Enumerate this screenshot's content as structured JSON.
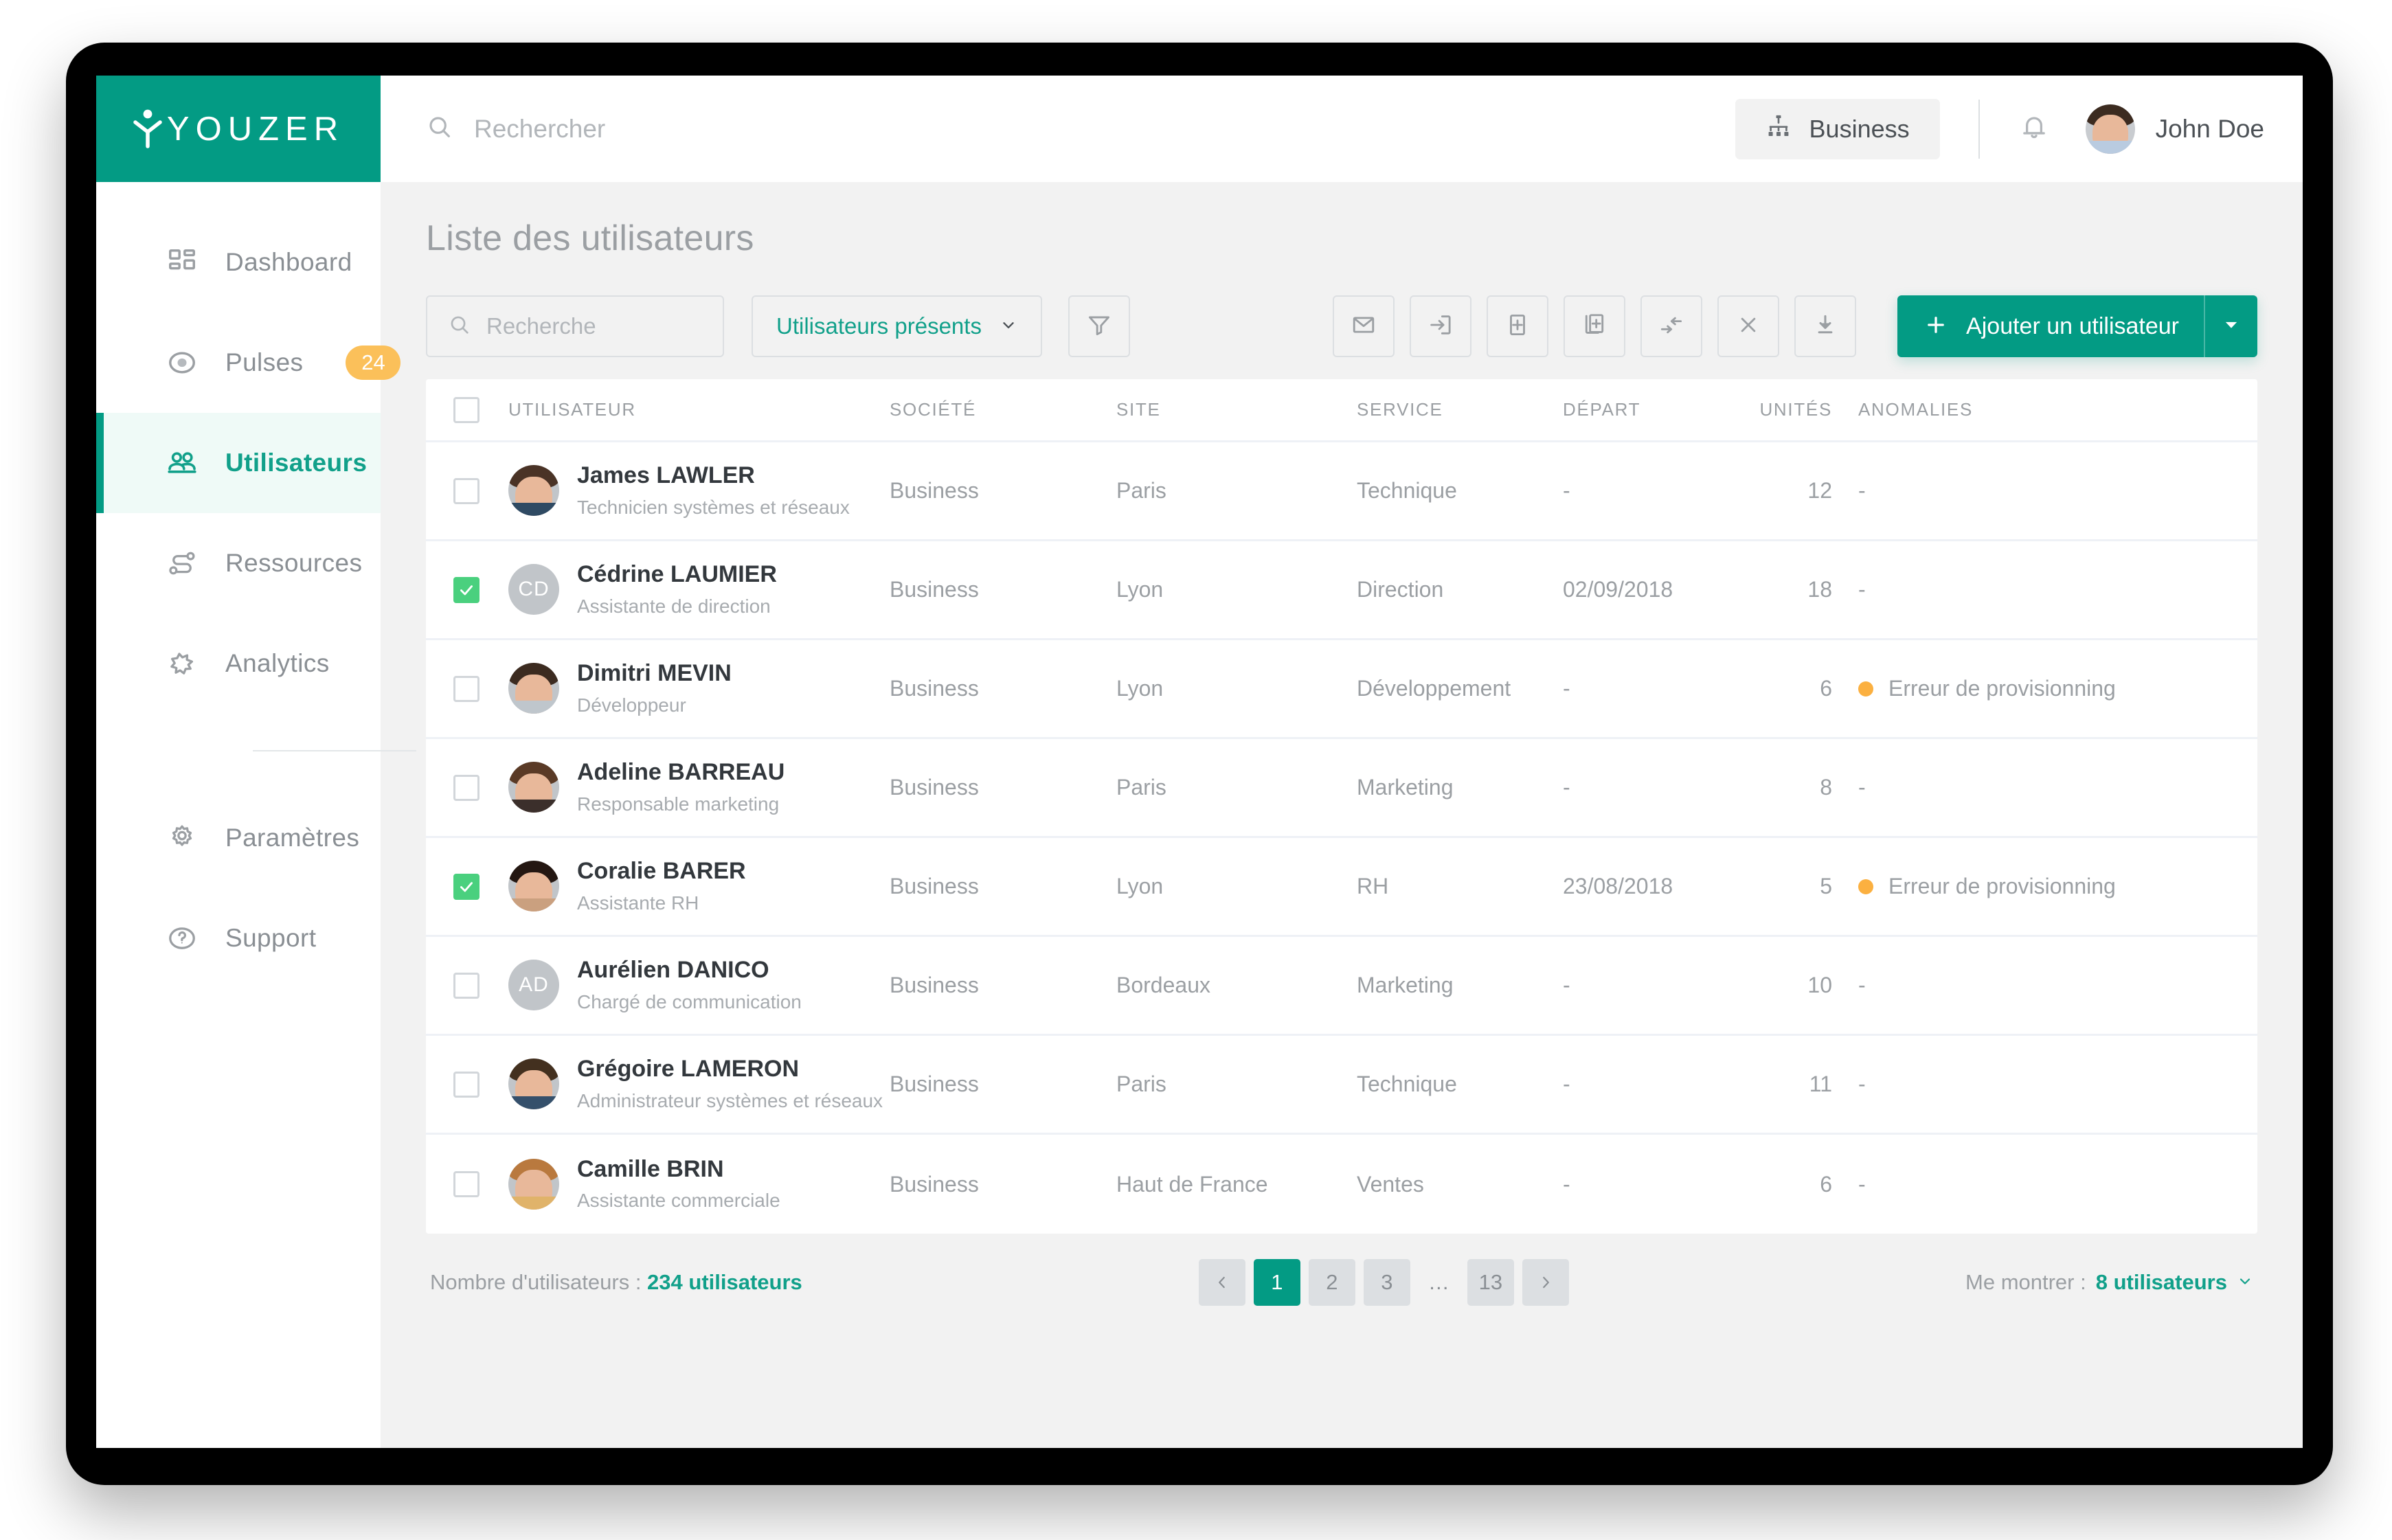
{
  "brand": {
    "name": "YOUZER",
    "color": "#039b84"
  },
  "sidebar": {
    "items": [
      {
        "label": "Dashboard",
        "icon": "dashboard-icon",
        "badge": null,
        "active": false
      },
      {
        "label": "Pulses",
        "icon": "pulse-icon",
        "badge": "24",
        "active": false
      },
      {
        "label": "Utilisateurs",
        "icon": "users-icon",
        "badge": null,
        "active": true
      },
      {
        "label": "Ressources",
        "icon": "resources-icon",
        "badge": null,
        "active": false
      },
      {
        "label": "Analytics",
        "icon": "analytics-icon",
        "badge": null,
        "active": false
      },
      {
        "label": "Paramètres",
        "icon": "gear-icon",
        "badge": null,
        "active": false
      },
      {
        "label": "Support",
        "icon": "help-icon",
        "badge": null,
        "active": false
      }
    ]
  },
  "topbar": {
    "search_placeholder": "Rechercher",
    "search_value": "",
    "search_icon": "search-icon",
    "business_label": "Business",
    "business_icon": "org-chart-icon",
    "bell_icon": "bell-icon",
    "user_name": "John Doe",
    "avatar_icon": "avatar"
  },
  "page": {
    "title": "Liste des utilisateurs"
  },
  "toolbar": {
    "search_placeholder": "Recherche",
    "search_value": "",
    "search_icon": "search-icon",
    "status_filter_label": "Utilisateurs présents",
    "status_filter_caret": "chevron-down-icon",
    "filter_icon": "funnel-icon",
    "actions": [
      {
        "name": "mail-button",
        "icon": "envelope-icon"
      },
      {
        "name": "import-button",
        "icon": "arrow-into-box-icon"
      },
      {
        "name": "add-document-button",
        "icon": "plus-in-box-icon"
      },
      {
        "name": "duplicate-button",
        "icon": "copy-plus-icon"
      },
      {
        "name": "merge-button",
        "icon": "merge-arrows-icon"
      },
      {
        "name": "close-button",
        "icon": "x-icon"
      },
      {
        "name": "download-button",
        "icon": "download-icon"
      }
    ],
    "add_user_label": "Ajouter un utilisateur",
    "add_user_plus_icon": "plus-icon",
    "add_user_caret_icon": "caret-down-icon"
  },
  "table": {
    "columns": [
      "UTILISATEUR",
      "SOCIÉTÉ",
      "SITE",
      "SERVICE",
      "DÉPART",
      "UNITÉS",
      "ANOMALIES"
    ],
    "select_all_checked": false,
    "rows": [
      {
        "checked": false,
        "avatar_type": "photo",
        "avatar_initials": "",
        "name": "James LAWLER",
        "role": "Technicien systèmes et réseaux",
        "societe": "Business",
        "site": "Paris",
        "service": "Technique",
        "depart": "-",
        "unites": "12",
        "anomalie": "-",
        "anomalie_flag": false
      },
      {
        "checked": true,
        "avatar_type": "initials",
        "avatar_initials": "CD",
        "name": "Cédrine LAUMIER",
        "role": "Assistante de direction",
        "societe": "Business",
        "site": "Lyon",
        "service": "Direction",
        "depart": "02/09/2018",
        "unites": "18",
        "anomalie": "-",
        "anomalie_flag": false
      },
      {
        "checked": false,
        "avatar_type": "photo",
        "avatar_initials": "",
        "name": "Dimitri MEVIN",
        "role": "Développeur",
        "societe": "Business",
        "site": "Lyon",
        "service": "Développement",
        "depart": "-",
        "unites": "6",
        "anomalie": "Erreur de provisionning",
        "anomalie_flag": true
      },
      {
        "checked": false,
        "avatar_type": "photo",
        "avatar_initials": "",
        "name": "Adeline BARREAU",
        "role": "Responsable marketing",
        "societe": "Business",
        "site": "Paris",
        "service": "Marketing",
        "depart": "-",
        "unites": "8",
        "anomalie": "-",
        "anomalie_flag": false
      },
      {
        "checked": true,
        "avatar_type": "photo",
        "avatar_initials": "",
        "name": "Coralie BARER",
        "role": "Assistante RH",
        "societe": "Business",
        "site": "Lyon",
        "service": "RH",
        "depart": "23/08/2018",
        "unites": "5",
        "anomalie": "Erreur de provisionning",
        "anomalie_flag": true
      },
      {
        "checked": false,
        "avatar_type": "initials",
        "avatar_initials": "AD",
        "name": "Aurélien DANICO",
        "role": "Chargé de communication",
        "societe": "Business",
        "site": "Bordeaux",
        "service": "Marketing",
        "depart": "-",
        "unites": "10",
        "anomalie": "-",
        "anomalie_flag": false
      },
      {
        "checked": false,
        "avatar_type": "photo",
        "avatar_initials": "",
        "name": "Grégoire LAMERON",
        "role": "Administrateur systèmes et réseaux",
        "societe": "Business",
        "site": "Paris",
        "service": "Technique",
        "depart": "-",
        "unites": "11",
        "anomalie": "-",
        "anomalie_flag": false
      },
      {
        "checked": false,
        "avatar_type": "photo",
        "avatar_initials": "",
        "name": "Camille BRIN",
        "role": "Assistante commerciale",
        "societe": "Business",
        "site": "Haut de France",
        "service": "Ventes",
        "depart": "-",
        "unites": "6",
        "anomalie": "-",
        "anomalie_flag": false
      }
    ]
  },
  "footer": {
    "count_label": "Nombre d'utilisateurs : ",
    "count_value": "234 utilisateurs",
    "pagination": {
      "prev_icon": "chevron-left-icon",
      "next_icon": "chevron-right-icon",
      "pages": [
        "1",
        "2",
        "3",
        "…",
        "13"
      ],
      "current": "1"
    },
    "show_label": "Me montrer : ",
    "show_value": "8 utilisateurs",
    "show_caret": "chevron-down-icon"
  },
  "colors": {
    "teal": "#039b84",
    "teal_text": "#11a08a",
    "amber": "#fbb040",
    "badge_amber": "#fbc05a",
    "green_check": "#4ad07e"
  }
}
